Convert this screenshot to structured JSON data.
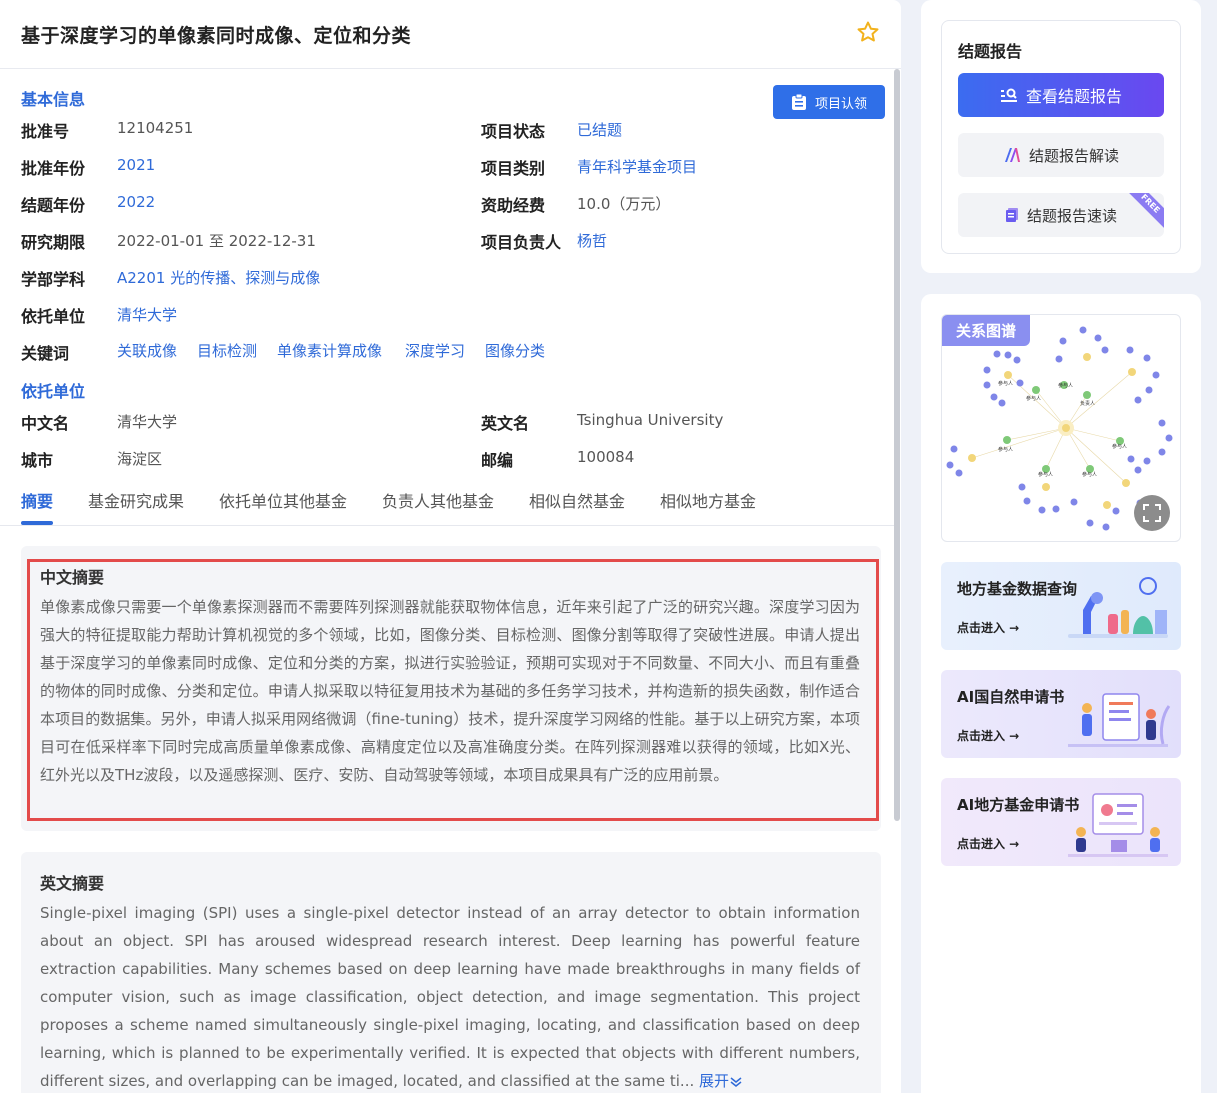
{
  "project": {
    "title": "基于深度学习的单像素同时成像、定位和分类",
    "basic_info_title": "基本信息",
    "claim_button": "项目认领",
    "fields": {
      "approval_no_label": "批准号",
      "approval_no": "12104251",
      "status_label": "项目状态",
      "status": "已结题",
      "approval_year_label": "批准年份",
      "approval_year": "2021",
      "category_label": "项目类别",
      "category": "青年科学基金项目",
      "conclusion_year_label": "结题年份",
      "conclusion_year": "2022",
      "funding_label": "资助经费",
      "funding": "10.0（万元）",
      "period_label": "研究期限",
      "period": "2022-01-01 至 2022-12-31",
      "leader_label": "项目负责人",
      "leader": "杨哲",
      "discipline_label": "学部学科",
      "discipline": "A2201 光的传播、探测与成像",
      "institution_label": "依托单位",
      "institution": "清华大学",
      "keywords_label": "关键词",
      "keywords": [
        "关联成像",
        "目标检测",
        "单像素计算成像",
        "深度学习",
        "图像分类"
      ]
    },
    "institution_section": {
      "title": "依托单位",
      "cn_name_label": "中文名",
      "cn_name": "清华大学",
      "en_name_label": "英文名",
      "en_name": "Tsinghua University",
      "city_label": "城市",
      "city": "海淀区",
      "zip_label": "邮编",
      "zip": "100084"
    },
    "tabs": [
      "摘要",
      "基金研究成果",
      "依托单位其他基金",
      "负责人其他基金",
      "相似自然基金",
      "相似地方基金"
    ],
    "abstract_cn": {
      "title": "中文摘要",
      "text": "单像素成像只需要一个单像素探测器而不需要阵列探测器就能获取物体信息，近年来引起了广泛的研究兴趣。深度学习因为强大的特征提取能力帮助计算机视觉的多个领域，比如，图像分类、目标检测、图像分割等取得了突破性进展。申请人提出基于深度学习的单像素同时成像、定位和分类的方案，拟进行实验验证，预期可实现对于不同数量、不同大小、而且有重叠的物体的同时成像、分类和定位。申请人拟采取以特征复用技术为基础的多任务学习技术，并构造新的损失函数，制作适合本项目的数据集。另外，申请人拟采用网络微调（fine-tuning）技术，提升深度学习网络的性能。基于以上研究方案，本项目可在低采样率下同时完成高质量单像素成像、高精度定位以及高准确度分类。在阵列探测器难以获得的领域，比如X光、红外光以及THz波段，以及遥感探测、医疗、安防、自动驾驶等领域，本项目成果具有广泛的应用前景。"
    },
    "abstract_en": {
      "title": "英文摘要",
      "text": "Single-pixel imaging (SPI) uses a single-pixel detector instead of an array detector to obtain information about an object. SPI has aroused widespread research interest. Deep learning has powerful feature extraction capabilities. Many schemes based on deep learning have made breakthroughs in many fields of computer vision, such as image classification, object detection, and image segmentation. This project proposes a scheme named simultaneously single-pixel imaging, locating, and classification based on deep learning, which is planned to be experimentally verified. It is expected that objects with different numbers, different sizes, and overlapping can be imaged, located, and classified at the same ti...",
      "expand": "展开"
    }
  },
  "sidebar": {
    "report_title": "结题报告",
    "view_report": "查看结题报告",
    "report_interpret": "结题报告解读",
    "report_quick": "结题报告速读",
    "free_tag": "FREE",
    "graph_title": "关系图谱",
    "graph_labels": [
      "参与人",
      "参与人",
      "负责人",
      "参与人",
      "参与人",
      "参与人",
      "参与人",
      "参与人"
    ],
    "promos": [
      {
        "title": "地方基金数据查询",
        "enter": "点击进入 →"
      },
      {
        "title": "AI国自然申请书",
        "enter": "点击进入 →"
      },
      {
        "title": "AI地方基金申请书",
        "enter": "点击进入 →"
      }
    ]
  },
  "colors": {
    "accent": "#2f6ad8",
    "highlight": "#e34b4b",
    "gradient_start": "#3b6cf0",
    "gradient_end": "#6a48f0"
  }
}
